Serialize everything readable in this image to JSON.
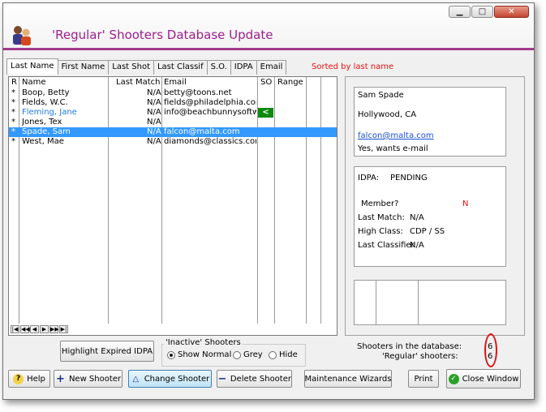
{
  "window": {
    "title": "'Regular' Shooters Database Update"
  },
  "window_controls": {
    "minimize": "▁",
    "maximize": "□",
    "close": "✕"
  },
  "tabs": [
    "Last Name",
    "First Name",
    "Last Shot",
    "Last Classif",
    "S.O.",
    "IDPA",
    "Email"
  ],
  "sort_status": "Sorted by last name",
  "grid": {
    "headers": {
      "r": "R",
      "name": "Name",
      "last_match": "Last Match",
      "email": "Email",
      "so": "SO",
      "range": "Range"
    },
    "rows": [
      {
        "marker": "*",
        "name": "Boop, Betty",
        "last_match": "N/A",
        "email": "betty@toons.net",
        "so": ""
      },
      {
        "marker": "*",
        "name": "Fields, W.C.",
        "last_match": "N/A",
        "email": "fields@philadelphia.com",
        "so": ""
      },
      {
        "marker": "*",
        "name": "Fleming, Jane",
        "last_match": "N/A",
        "email": "info@beachbunnysoftware",
        "so": "<"
      },
      {
        "marker": "*",
        "name": "Jones, Tex",
        "last_match": "N/A",
        "email": "",
        "so": ""
      },
      {
        "marker": "*",
        "name": "Spade, Sam",
        "last_match": "N/A",
        "email": "falcon@malta.com",
        "so": ""
      },
      {
        "marker": "*",
        "name": "West, Mae",
        "last_match": "N/A",
        "email": "diamonds@classics.com",
        "so": ""
      }
    ],
    "nav": [
      "|◀",
      "◀◀",
      "◀",
      "▶",
      "▶▶",
      "▶|"
    ]
  },
  "detail": {
    "name": "Sam  Spade",
    "city": "Hollywood, CA",
    "email": "falcon@malta.com",
    "email_pref": "Yes, wants e-mail",
    "idpa_label": "IDPA:",
    "idpa_value": "PENDING",
    "member_label": "Member?",
    "member_value": "N",
    "last_match_label": "Last Match:",
    "last_match_value": "N/A",
    "high_class_label": "High Class:",
    "high_class_value": "CDP / SS",
    "last_classifier_label": "Last Classifier",
    "last_classifier_value": "N/A"
  },
  "highlight_button": "Highlight  Expired IDPA",
  "inactive_group": {
    "title": "'Inactive' Shooters",
    "options": [
      {
        "label": "Show Normal",
        "checked": true
      },
      {
        "label": "Grey",
        "checked": false
      },
      {
        "label": "Hide",
        "checked": false
      }
    ]
  },
  "stats": {
    "db_label": "Shooters in the database:",
    "db_count": "6",
    "regular_label": "'Regular' shooters:",
    "regular_count": "6"
  },
  "buttons": {
    "help": "Help",
    "new_shooter": "New Shooter",
    "change_shooter": "Change Shooter",
    "delete_shooter": "Delete Shooter",
    "maintenance": "Maintenance Wizards",
    "print": "Print",
    "close_window": "Close Window"
  },
  "colors": {
    "accent": "#9b1f8c",
    "selection": "#3399ff",
    "so_marker": "#0b8a0b",
    "alert": "#e81010"
  }
}
